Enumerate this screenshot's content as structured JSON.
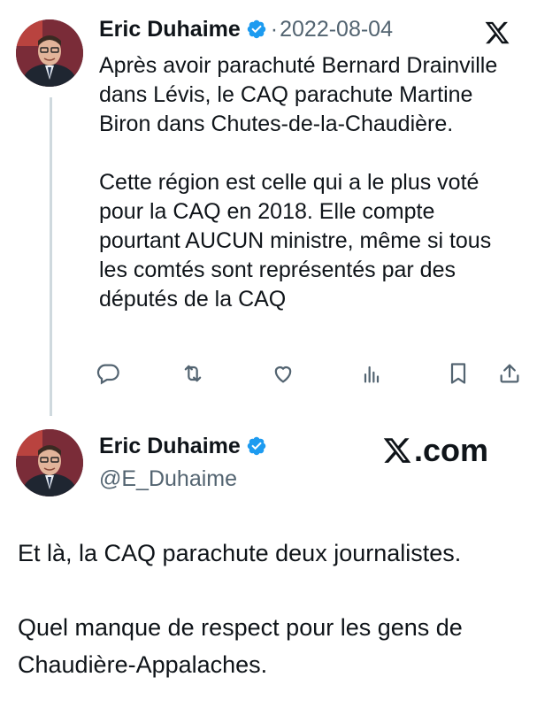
{
  "tweet1": {
    "author_name": "Eric Duhaime",
    "date": "2022-08-04",
    "separator": "·",
    "text": "Après avoir parachuté Bernard Drainville dans Lévis, le CAQ parachute Martine Biron dans Chutes-de-la-Chaudière.\n\nCette région est celle qui a le plus voté pour la CAQ en 2018. Elle compte pourtant AUCUN ministre, même si tous les comtés sont représentés par des députés de la CAQ",
    "actions": [
      "reply-icon",
      "retweet-icon",
      "like-icon",
      "views-icon",
      "bookmark-icon",
      "share-icon"
    ]
  },
  "tweet2": {
    "author_name": "Eric Duhaime",
    "handle": "@E_Duhaime",
    "watermark": ".com",
    "text": "Et là, la CAQ parachute deux journalistes.\n\nQuel manque de respect pour les gens de Chaudière-Appalaches."
  },
  "colors": {
    "text": "#0f1419",
    "muted": "#536471",
    "verified": "#1d9bf0",
    "thread_line": "#cfd9de"
  }
}
